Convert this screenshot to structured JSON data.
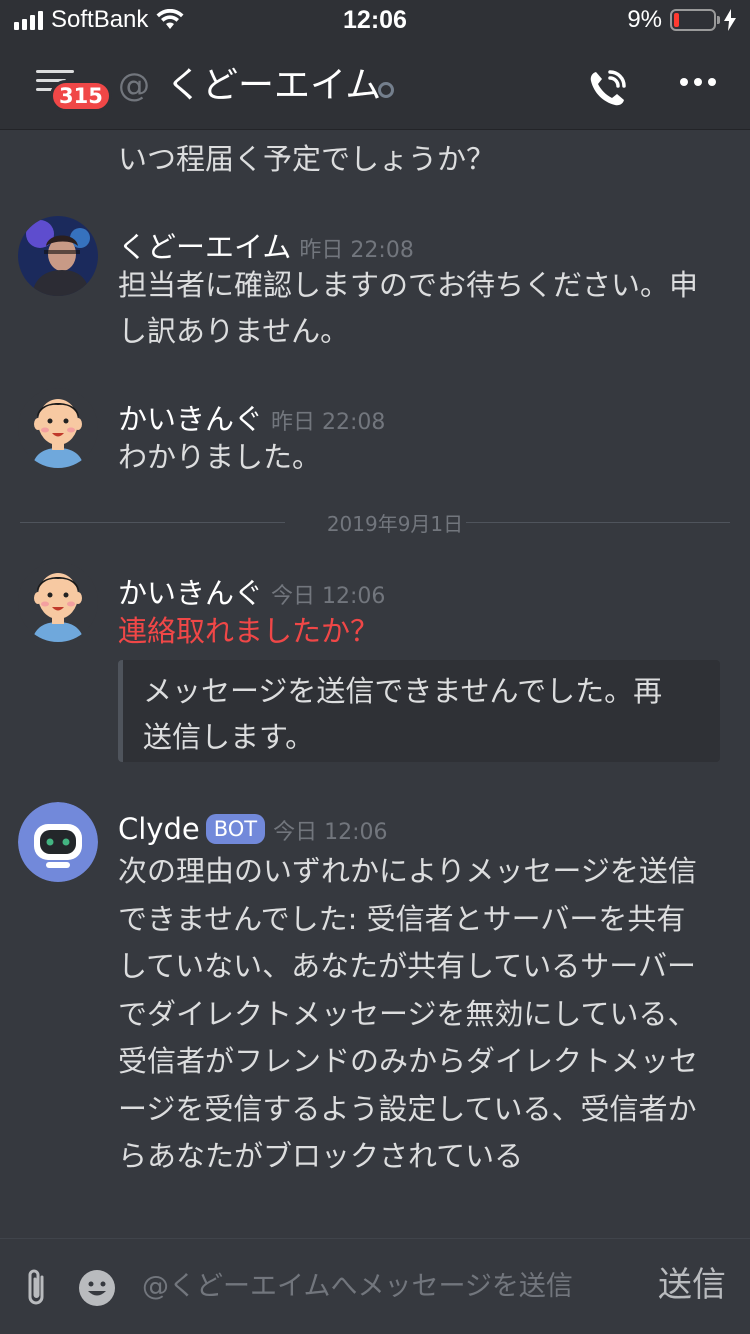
{
  "status_bar": {
    "carrier": "SoftBank",
    "time": "12:06",
    "battery": "9%",
    "battery_level": 0.09
  },
  "header": {
    "badge_count": "315",
    "at_symbol": "@",
    "dm_name": "くどーエイム"
  },
  "messages": [
    {
      "text": "いつ程届く予定でしょうか？"
    },
    {
      "author": "くどーエイム",
      "timestamp": "昨日 22:08",
      "lines": [
        "担当者に確認しますのでお待ちください。申",
        "し訳ありません。"
      ]
    },
    {
      "author": "かいきんぐ",
      "timestamp": "昨日 22:08",
      "lines": [
        "わかりました。"
      ]
    },
    {
      "author": "かいきんぐ",
      "timestamp": "今日 12:06",
      "text": "連絡取れましたか？",
      "error_embed": [
        "メッセージを送信できませんでした。再",
        "送信します。"
      ]
    },
    {
      "author": "Clyde",
      "bot_tag": "BOT",
      "timestamp": "今日 12:06",
      "lines": [
        "次の理由のいずれかによりメッセージを送信",
        "できませんでした: 受信者とサーバーを共有",
        "していない、あなたが共有しているサーバー",
        "でダイレクトメッセージを無効にしている、",
        "受信者がフレンドのみからダイレクトメッセ",
        "ージを受信するよう設定している、受信者か",
        "らあなたがブロックされている"
      ]
    }
  ],
  "date_divider": "2019年9月1日",
  "composer": {
    "placeholder": "@くどーエイムへメッセージを送信",
    "send_label": "送信"
  },
  "colors": {
    "background": "#36393f",
    "header": "#2f3136",
    "error_text": "#f04747",
    "bot_badge": "#7289da",
    "mention_badge": "#f04747"
  },
  "icons": [
    "menu-icon",
    "at-icon",
    "status-idle-icon",
    "call-icon",
    "more-icon",
    "attachment-icon",
    "emoji-icon"
  ]
}
